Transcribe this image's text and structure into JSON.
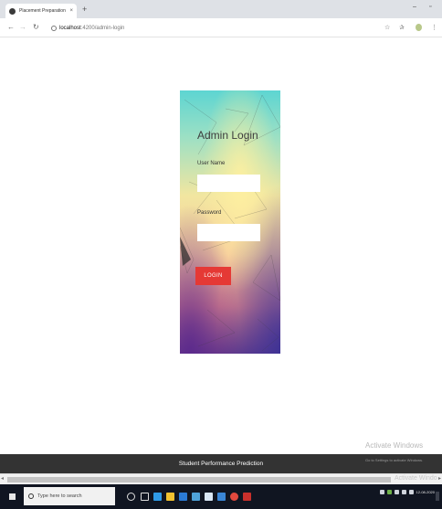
{
  "browser": {
    "tab_title": "Placement Preparation",
    "tab_close": "×",
    "new_tab": "+",
    "url_host": "localhost",
    "url_path": ":4200/admin-login"
  },
  "login": {
    "title": "Admin Login",
    "username_label": "User Name",
    "username_value": "",
    "password_label": "Password",
    "password_value": "",
    "button_label": "LOGIN"
  },
  "footer": {
    "text": "Student Performance Prediction"
  },
  "watermark": {
    "title": "Activate Windows",
    "subtitle": "Go to Settings to activate Windows."
  },
  "taskbar": {
    "search_placeholder": "Type here to search",
    "date": "12-08-2020"
  },
  "colors": {
    "login_button": "#e53935",
    "footer_bg": "#333333",
    "taskbar_bg": "#101521"
  }
}
